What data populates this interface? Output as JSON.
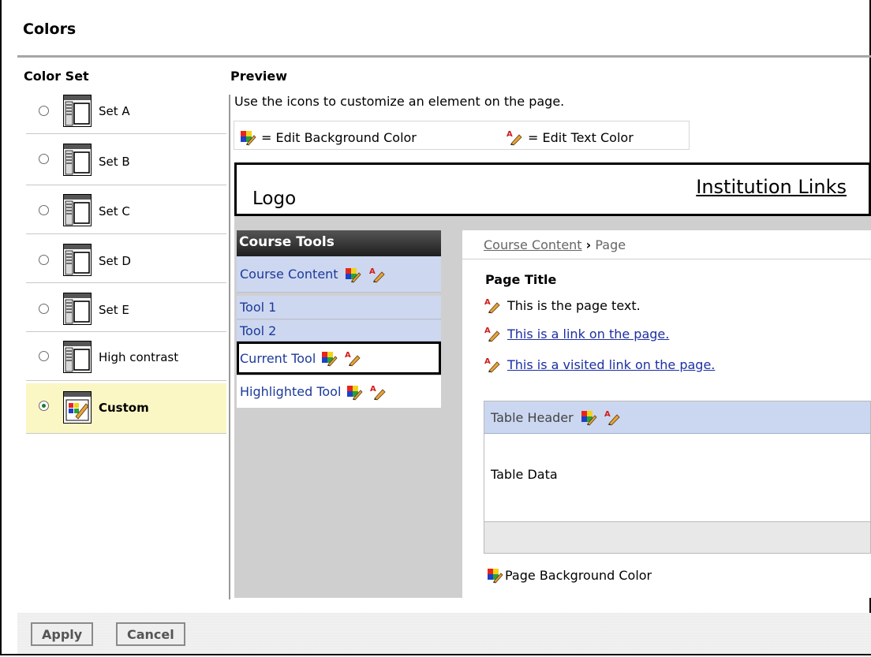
{
  "page": {
    "title": "Colors"
  },
  "color_set": {
    "heading": "Color Set",
    "selected": "Custom",
    "options": [
      {
        "label": "Set A",
        "checked": false
      },
      {
        "label": "Set B",
        "checked": false
      },
      {
        "label": "Set C",
        "checked": false
      },
      {
        "label": "Set D",
        "checked": false
      },
      {
        "label": "Set E",
        "checked": false
      },
      {
        "label": "High contrast",
        "checked": false
      },
      {
        "label": "Custom",
        "checked": true
      }
    ]
  },
  "preview": {
    "heading": "Preview",
    "instruction": "Use the icons to customize an element on the page.",
    "legend": {
      "bg": "= Edit Background Color",
      "text": "= Edit Text Color"
    },
    "header": {
      "logo": "Logo",
      "links": "Institution Links"
    },
    "course_tools": {
      "heading": "Course Tools",
      "items": [
        "Course Content",
        "Tool 1",
        "Tool 2",
        "Current Tool",
        "Highlighted Tool"
      ]
    },
    "content": {
      "breadcrumb_link": "Course Content",
      "breadcrumb_sep": "›",
      "breadcrumb_current": "Page",
      "page_title": "Page Title",
      "page_text": "This is the page text.",
      "link_text": "This is a link on the page.",
      "visited_link_text": "This is a visited link on the page.",
      "table_header": "Table Header",
      "table_data": "Table Data",
      "page_bg": "Page Background Color"
    }
  },
  "buttons": {
    "apply": "Apply",
    "cancel": "Cancel"
  },
  "colors": {
    "tool_bg": "#cdd7ef",
    "selected_row": "#fbf7c4",
    "link": "#1d2fa3"
  }
}
